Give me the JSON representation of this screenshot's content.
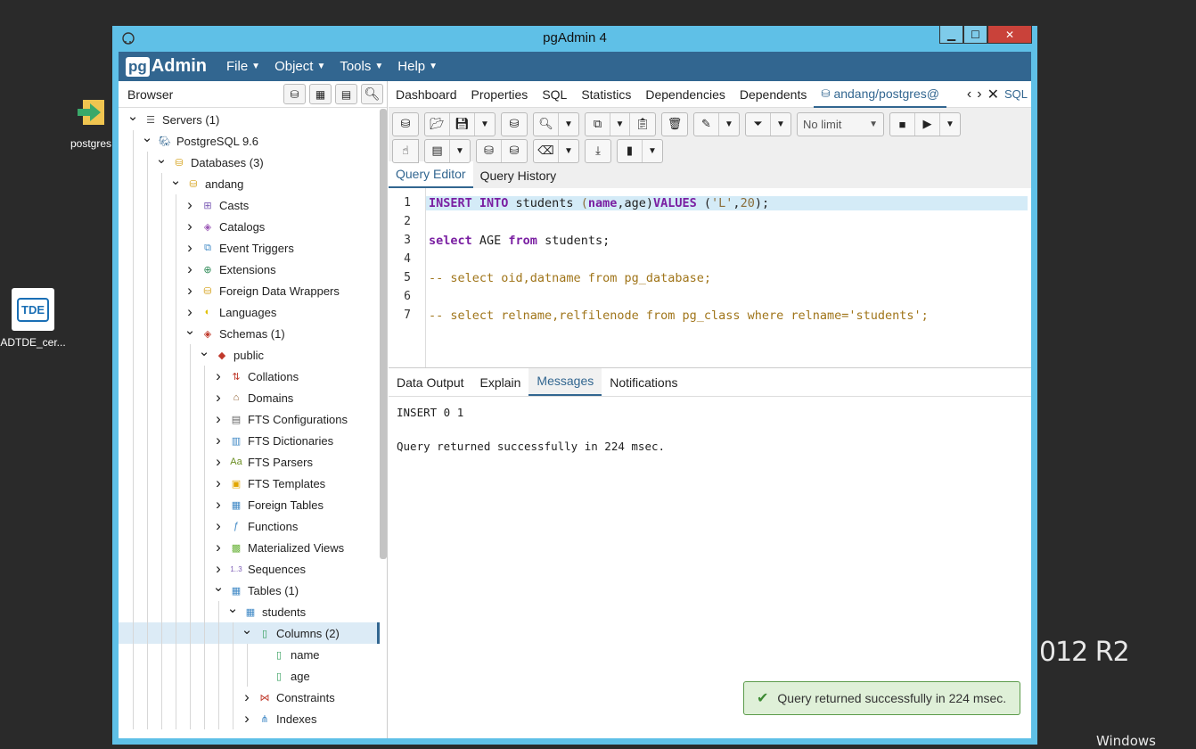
{
  "desktop": {
    "icons": [
      {
        "label": "postgres",
        "icon": "shortcut-icon"
      },
      {
        "label": "ADTDE_cer...",
        "icon": "tde-certificate-icon",
        "badge": "TDE"
      }
    ],
    "brand_text": "012 R2",
    "brand_caption": "Windows Serve"
  },
  "window": {
    "title": "pgAdmin 4",
    "minimize": "▁",
    "maximize": "☐",
    "close": "✕"
  },
  "menubar": {
    "logo_pg": "pg",
    "logo_admin": "Admin",
    "items": [
      "File",
      "Object",
      "Tools",
      "Help"
    ]
  },
  "browser": {
    "title": "Browser",
    "tree": [
      {
        "label": "Servers (1)",
        "depth": 0,
        "caret": "v",
        "icon": "servers-icon"
      },
      {
        "label": "PostgreSQL 9.6",
        "depth": 1,
        "caret": "v",
        "icon": "elephant-icon"
      },
      {
        "label": "Databases (3)",
        "depth": 2,
        "caret": "v",
        "icon": "databases-icon"
      },
      {
        "label": "andang",
        "depth": 3,
        "caret": "v",
        "icon": "database-icon"
      },
      {
        "label": "Casts",
        "depth": 4,
        "caret": ">",
        "icon": "casts-icon"
      },
      {
        "label": "Catalogs",
        "depth": 4,
        "caret": ">",
        "icon": "catalogs-icon"
      },
      {
        "label": "Event Triggers",
        "depth": 4,
        "caret": ">",
        "icon": "event-triggers-icon"
      },
      {
        "label": "Extensions",
        "depth": 4,
        "caret": ">",
        "icon": "extensions-icon"
      },
      {
        "label": "Foreign Data Wrappers",
        "depth": 4,
        "caret": ">",
        "icon": "fdw-icon"
      },
      {
        "label": "Languages",
        "depth": 4,
        "caret": ">",
        "icon": "languages-icon"
      },
      {
        "label": "Schemas (1)",
        "depth": 4,
        "caret": "v",
        "icon": "schemas-icon"
      },
      {
        "label": "public",
        "depth": 5,
        "caret": "v",
        "icon": "schema-icon"
      },
      {
        "label": "Collations",
        "depth": 6,
        "caret": ">",
        "icon": "collations-icon"
      },
      {
        "label": "Domains",
        "depth": 6,
        "caret": ">",
        "icon": "domains-icon"
      },
      {
        "label": "FTS Configurations",
        "depth": 6,
        "caret": ">",
        "icon": "fts-config-icon"
      },
      {
        "label": "FTS Dictionaries",
        "depth": 6,
        "caret": ">",
        "icon": "fts-dict-icon"
      },
      {
        "label": "FTS Parsers",
        "depth": 6,
        "caret": ">",
        "icon": "fts-parser-icon"
      },
      {
        "label": "FTS Templates",
        "depth": 6,
        "caret": ">",
        "icon": "fts-template-icon"
      },
      {
        "label": "Foreign Tables",
        "depth": 6,
        "caret": ">",
        "icon": "foreign-tables-icon"
      },
      {
        "label": "Functions",
        "depth": 6,
        "caret": ">",
        "icon": "functions-icon"
      },
      {
        "label": "Materialized Views",
        "depth": 6,
        "caret": ">",
        "icon": "mview-icon"
      },
      {
        "label": "Sequences",
        "depth": 6,
        "caret": ">",
        "icon": "sequences-icon"
      },
      {
        "label": "Tables (1)",
        "depth": 6,
        "caret": "v",
        "icon": "tables-icon"
      },
      {
        "label": "students",
        "depth": 7,
        "caret": "v",
        "icon": "table-icon"
      },
      {
        "label": "Columns (2)",
        "depth": 8,
        "caret": "v",
        "icon": "columns-icon",
        "selected": true
      },
      {
        "label": "name",
        "depth": 9,
        "caret": "",
        "icon": "column-icon"
      },
      {
        "label": "age",
        "depth": 9,
        "caret": "",
        "icon": "column-icon"
      },
      {
        "label": "Constraints",
        "depth": 8,
        "caret": ">",
        "icon": "constraints-icon"
      },
      {
        "label": "Indexes",
        "depth": 8,
        "caret": ">",
        "icon": "indexes-icon"
      }
    ]
  },
  "main_tabs": [
    "Dashboard",
    "Properties",
    "SQL",
    "Statistics",
    "Dependencies",
    "Dependents",
    "andang/postgres@"
  ],
  "main_tab_overflow": "SQL",
  "toolbar": {
    "limit_select": "No limit"
  },
  "editor_tabs": [
    "Query Editor",
    "Query History"
  ],
  "editor": {
    "lines": [
      {
        "n": "1"
      },
      {
        "n": "2"
      },
      {
        "n": "3"
      },
      {
        "n": "4"
      },
      {
        "n": "5"
      },
      {
        "n": "6"
      },
      {
        "n": "7"
      }
    ],
    "l1": {
      "a": "INSERT INTO",
      "b": " students ",
      "c": "(",
      "d": "name",
      "e": ",age)",
      "f": "VALUES",
      "g": " (",
      "h": "'L'",
      "i": ",",
      "j": "20",
      "k": ");"
    },
    "l3": {
      "a": "select",
      "b": " AGE ",
      "c": "from",
      "d": " students;"
    },
    "l5": "-- select oid,datname from pg_database;",
    "l7": "-- select relname,relfilenode from pg_class where relname='students';"
  },
  "output_tabs": [
    "Data Output",
    "Explain",
    "Messages",
    "Notifications"
  ],
  "messages": {
    "line1": "INSERT 0 1",
    "line2": "Query returned successfully in 224 msec."
  },
  "toast": {
    "text": "Query returned successfully in 224 msec."
  }
}
